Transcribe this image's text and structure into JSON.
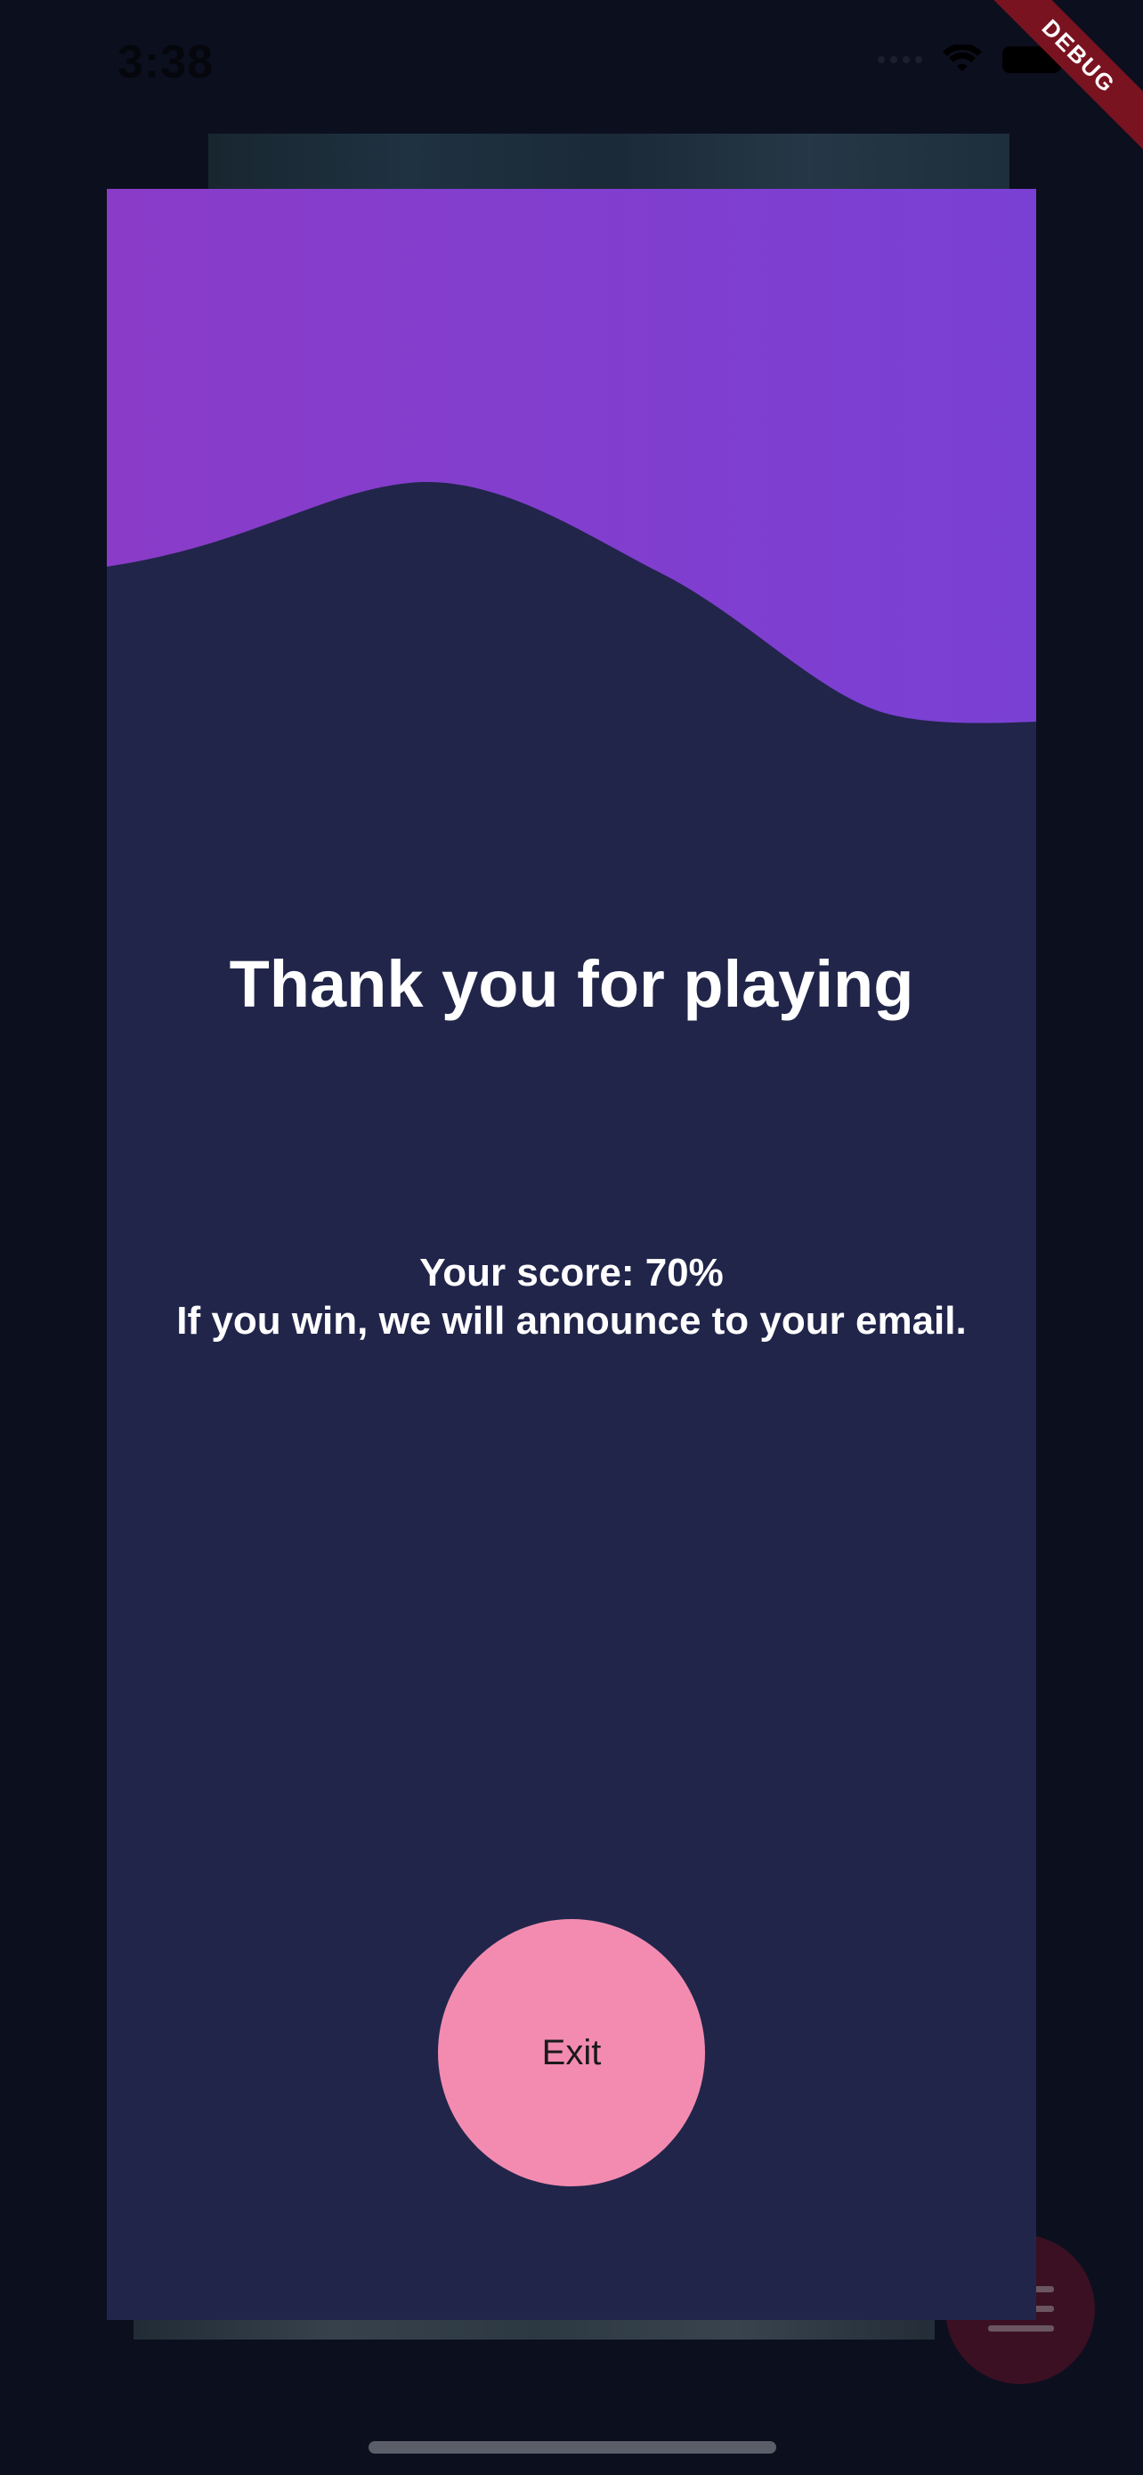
{
  "status_bar": {
    "time": "3:38",
    "wifi_icon": "wifi-icon",
    "battery_icon": "battery-icon"
  },
  "debug_banner": "DEBUG",
  "result_dialog": {
    "title": "Thank you for playing",
    "score_line": "Your score: 70%",
    "announce_line": "If you win, we will announce to your email.",
    "exit_label": "Exit"
  },
  "colors": {
    "wave_start": "#8a3cc8",
    "wave_end": "#7a40d4",
    "card_bg": "#21254a",
    "exit_button": "#f38bb0",
    "page_bg": "#0c0f1e"
  },
  "background_menu_icon": "menu-icon"
}
